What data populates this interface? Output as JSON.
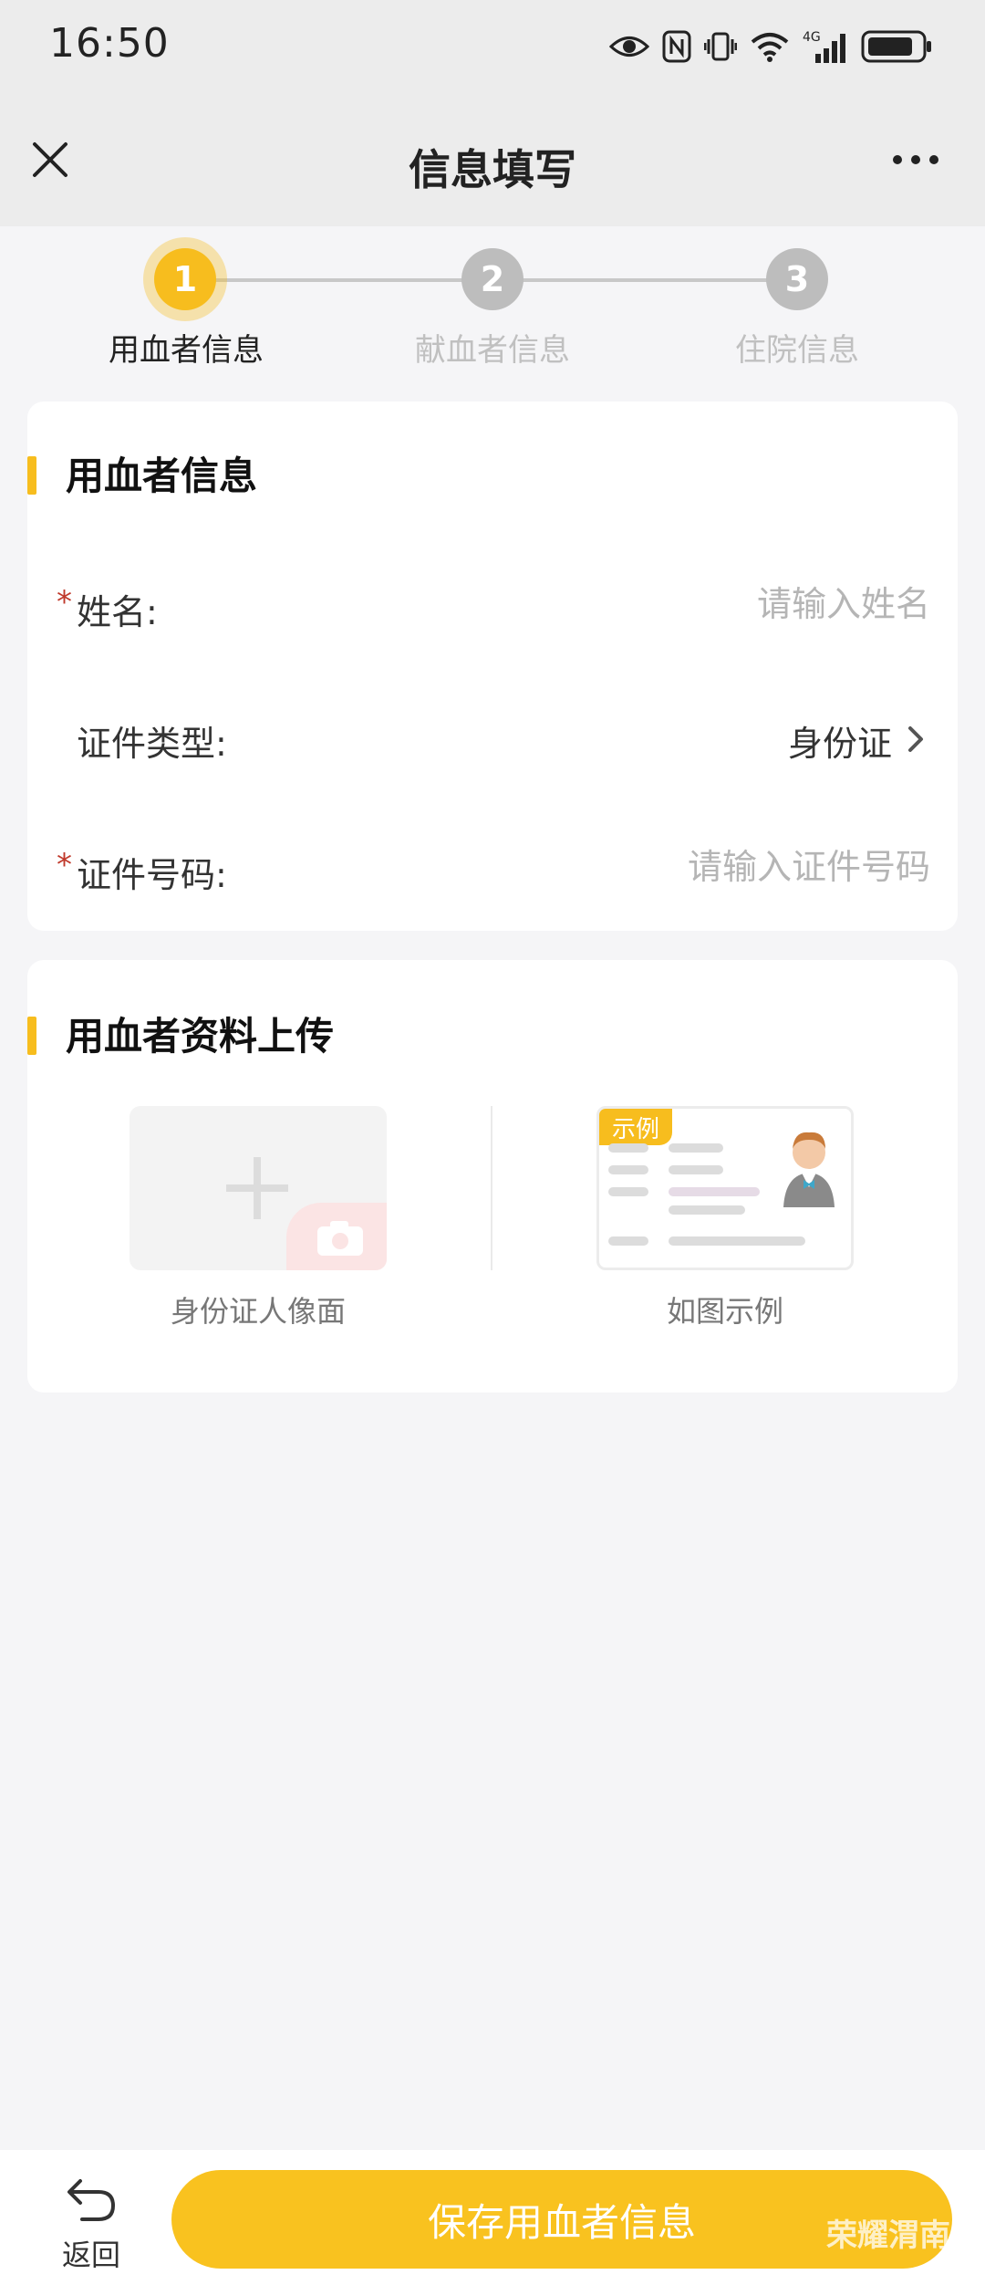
{
  "status_bar": {
    "time": "16:50",
    "network": "4G"
  },
  "header": {
    "title": "信息填写"
  },
  "stepper": {
    "steps": [
      {
        "number": "1",
        "label": "用血者信息"
      },
      {
        "number": "2",
        "label": "献血者信息"
      },
      {
        "number": "3",
        "label": "住院信息"
      }
    ]
  },
  "recipient_info": {
    "title": "用血者信息",
    "name": {
      "label": "姓名:",
      "placeholder": "请输入姓名",
      "required": true
    },
    "id_type": {
      "label": "证件类型:",
      "value": "身份证"
    },
    "id_number": {
      "label": "证件号码:",
      "placeholder": "请输入证件号码",
      "required": true
    }
  },
  "upload": {
    "title": "用血者资料上传",
    "id_front_caption": "身份证人像面",
    "example_tag": "示例",
    "example_caption": "如图示例"
  },
  "footer": {
    "back_label": "返回",
    "save_label": "保存用血者信息",
    "watermark": "荣耀渭南"
  },
  "colors": {
    "accent": "#f7bd1e",
    "required": "#c0392b",
    "background": "#f5f5f7"
  }
}
